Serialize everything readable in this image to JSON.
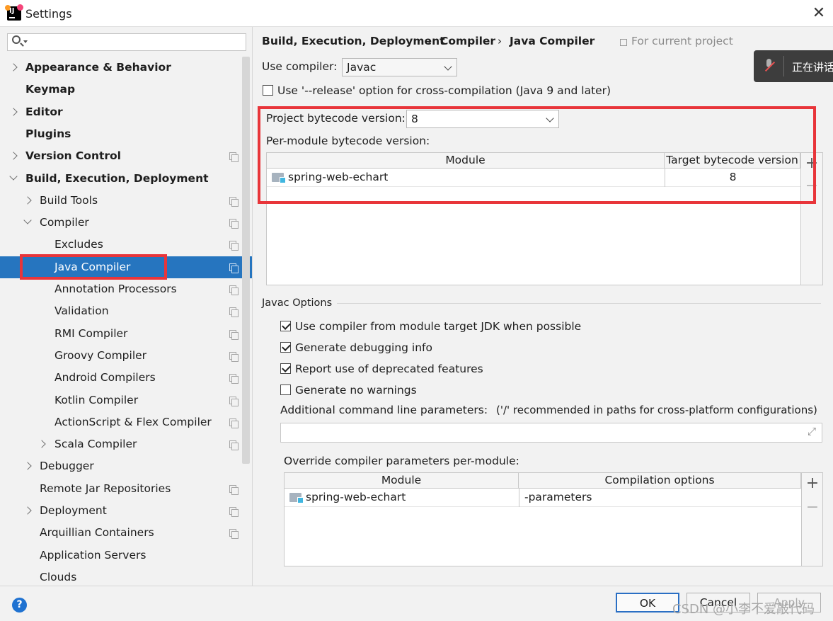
{
  "window": {
    "title": "Settings"
  },
  "search": {
    "placeholder": ""
  },
  "tree": [
    {
      "label": "Appearance & Behavior",
      "bold": true,
      "chevron": "right",
      "indent": 0,
      "copy": false
    },
    {
      "label": "Keymap",
      "bold": true,
      "chevron": "",
      "indent": 0,
      "copy": false
    },
    {
      "label": "Editor",
      "bold": true,
      "chevron": "right",
      "indent": 0,
      "copy": false
    },
    {
      "label": "Plugins",
      "bold": true,
      "chevron": "",
      "indent": 0,
      "copy": false
    },
    {
      "label": "Version Control",
      "bold": true,
      "chevron": "right",
      "indent": 0,
      "copy": true
    },
    {
      "label": "Build, Execution, Deployment",
      "bold": true,
      "chevron": "down",
      "indent": 0,
      "copy": false
    },
    {
      "label": "Build Tools",
      "bold": false,
      "chevron": "right",
      "indent": 1,
      "copy": true
    },
    {
      "label": "Compiler",
      "bold": false,
      "chevron": "down",
      "indent": 1,
      "copy": true
    },
    {
      "label": "Excludes",
      "bold": false,
      "chevron": "",
      "indent": 2,
      "copy": true
    },
    {
      "label": "Java Compiler",
      "bold": false,
      "chevron": "",
      "indent": 2,
      "copy": true,
      "selected": true
    },
    {
      "label": "Annotation Processors",
      "bold": false,
      "chevron": "",
      "indent": 2,
      "copy": true
    },
    {
      "label": "Validation",
      "bold": false,
      "chevron": "",
      "indent": 2,
      "copy": true
    },
    {
      "label": "RMI Compiler",
      "bold": false,
      "chevron": "",
      "indent": 2,
      "copy": true
    },
    {
      "label": "Groovy Compiler",
      "bold": false,
      "chevron": "",
      "indent": 2,
      "copy": true
    },
    {
      "label": "Android Compilers",
      "bold": false,
      "chevron": "",
      "indent": 2,
      "copy": true
    },
    {
      "label": "Kotlin Compiler",
      "bold": false,
      "chevron": "",
      "indent": 2,
      "copy": true
    },
    {
      "label": "ActionScript & Flex Compiler",
      "bold": false,
      "chevron": "",
      "indent": 2,
      "copy": true
    },
    {
      "label": "Scala Compiler",
      "bold": false,
      "chevron": "right",
      "indent": 2,
      "copy": true
    },
    {
      "label": "Debugger",
      "bold": false,
      "chevron": "right",
      "indent": 1,
      "copy": false
    },
    {
      "label": "Remote Jar Repositories",
      "bold": false,
      "chevron": "",
      "indent": 1,
      "copy": true
    },
    {
      "label": "Deployment",
      "bold": false,
      "chevron": "right",
      "indent": 1,
      "copy": true
    },
    {
      "label": "Arquillian Containers",
      "bold": false,
      "chevron": "",
      "indent": 1,
      "copy": true
    },
    {
      "label": "Application Servers",
      "bold": false,
      "chevron": "",
      "indent": 1,
      "copy": false
    },
    {
      "label": "Clouds",
      "bold": false,
      "chevron": "",
      "indent": 1,
      "copy": false
    }
  ],
  "breadcrumb": {
    "items": [
      "Build, Execution, Deployment",
      "Compiler",
      "Java Compiler"
    ],
    "separator": "›",
    "scope": "For current project"
  },
  "compiler": {
    "use_label": "Use compiler:",
    "use_value": "Javac",
    "release_label": "Use '--release' option for cross-compilation (Java 9 and later)",
    "release_checked": false,
    "project_bytecode_label": "Project bytecode version:",
    "project_bytecode_value": "8",
    "per_module_label": "Per-module bytecode version:"
  },
  "bytecode_table": {
    "columns": [
      "Module",
      "Target bytecode version"
    ],
    "rows": [
      {
        "module": "spring-web-echart",
        "version": "8"
      }
    ],
    "add_label": "+",
    "remove_label": "−"
  },
  "javac": {
    "section_title": "Javac Options",
    "options": [
      {
        "label": "Use compiler from module target JDK when possible",
        "checked": true
      },
      {
        "label": "Generate debugging info",
        "checked": true
      },
      {
        "label": "Report use of deprecated features",
        "checked": true
      },
      {
        "label": "Generate no warnings",
        "checked": false
      }
    ],
    "additional_label": "Additional command line parameters:",
    "additional_hint": "('/' recommended in paths for cross-platform configurations)",
    "additional_value": "",
    "override_label": "Override compiler parameters per-module:"
  },
  "override_table": {
    "columns": [
      "Module",
      "Compilation options"
    ],
    "rows": [
      {
        "module": "spring-web-echart",
        "options": "-parameters"
      }
    ],
    "add_label": "+",
    "remove_label": "−"
  },
  "buttons": {
    "ok": "OK",
    "cancel": "Cancel",
    "apply": "Apply",
    "help": "?"
  },
  "toast": {
    "text": "正在讲话"
  },
  "watermark": "CSDN @小李不爱敲代码",
  "colors": {
    "selection": "#2675bf",
    "highlight_box": "#e8353a",
    "accent": "#2a6fc4"
  }
}
